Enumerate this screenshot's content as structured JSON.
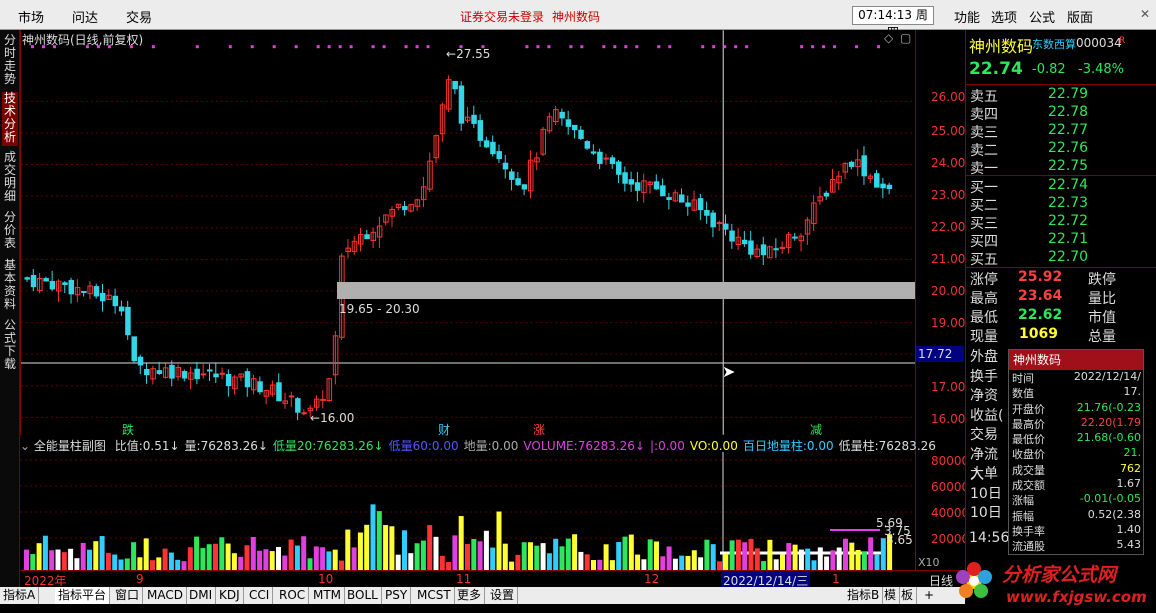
{
  "top": {
    "menu": [
      "市场",
      "问达",
      "交易"
    ],
    "alert": "证券交易未登录",
    "stock_name": "神州数码",
    "time": "07:14:13 周四",
    "right_menu": [
      "功能",
      "选项",
      "公式",
      "版面"
    ]
  },
  "left_tabs": [
    "分时走势",
    "技术分析",
    "成交明细",
    "分价表",
    "基本资料",
    "公式下载"
  ],
  "left_active": 1,
  "chart": {
    "title": "神州数码(日线,前复权)",
    "high_label": "27.55",
    "low_label": "16.00",
    "band_label": "19.65 - 20.30",
    "cursor_value": "17.72",
    "events": [
      "跌",
      "财",
      "涨",
      "减"
    ],
    "y_ticks": [
      "26.00",
      "25.00",
      "24.00",
      "23.00",
      "22.00",
      "21.00",
      "20.00",
      "19.00",
      "18.00",
      "17.00",
      "16.00"
    ]
  },
  "sub": {
    "name": "全能量柱副图",
    "items": [
      {
        "label": "比值:",
        "value": "0.51",
        "arrow": "↓",
        "color": "#dddddd"
      },
      {
        "label": "量:",
        "value": "76283.26",
        "arrow": "↓",
        "color": "#dddddd"
      },
      {
        "label": "低量20:",
        "value": "76283.26",
        "arrow": "↓",
        "color": "#2ee65a"
      },
      {
        "label": "低量60:",
        "value": "0.00",
        "arrow": "",
        "color": "#5555ff"
      },
      {
        "label": "地量:",
        "value": "0.00",
        "arrow": "",
        "color": "#aaaaaa"
      },
      {
        "label": "VOLUME:",
        "value": "76283.26",
        "arrow": "↓",
        "color": "#e040e0"
      },
      {
        "label": "|:",
        "value": "0.00",
        "arrow": "",
        "color": "#e040e0"
      },
      {
        "label": "VO:",
        "value": "0.00",
        "arrow": "",
        "color": "#ffff33"
      },
      {
        "label": "百日地量柱:",
        "value": "0.00",
        "arrow": "",
        "color": "#33ccff"
      },
      {
        "label": "低量柱:",
        "value": "76283.26",
        "arrow": "",
        "color": "#dddddd"
      }
    ],
    "y_ticks": [
      "80000",
      "60000",
      "40000",
      "20000"
    ],
    "labels": {
      "a": "5.69",
      "b": "3.75",
      "c": "3.65",
      "x10": "X10"
    }
  },
  "x_axis": {
    "labels": [
      "2022年",
      "9",
      "10",
      "11",
      "12",
      "1"
    ],
    "cursor_date": "2022/12/14/三",
    "right": "日线"
  },
  "bottom_tabs": [
    "指标A",
    "指标平台",
    "窗口",
    "MACD",
    "DMI",
    "KDJ",
    "CCI",
    "ROC",
    "MTM",
    "BOLL",
    "PSY",
    "MCST",
    "更多",
    "设置"
  ],
  "bottom_active": 1,
  "bottom_right": [
    "指标B",
    "模",
    "板",
    "+"
  ],
  "panel": {
    "name": "神州数码",
    "sub_name": "东数西算",
    "code": "000034",
    "rq": "R",
    "price": "22.74",
    "change": "-0.82",
    "change_pct": "-3.48%",
    "asks": [
      {
        "label": "卖五",
        "price": "22.79"
      },
      {
        "label": "卖四",
        "price": "22.78"
      },
      {
        "label": "卖三",
        "price": "22.77"
      },
      {
        "label": "卖二",
        "price": "22.76"
      },
      {
        "label": "卖一",
        "price": "22.75"
      }
    ],
    "bids": [
      {
        "label": "买一",
        "price": "22.74"
      },
      {
        "label": "买二",
        "price": "22.73"
      },
      {
        "label": "买三",
        "price": "22.72"
      },
      {
        "label": "买四",
        "price": "22.71"
      },
      {
        "label": "买五",
        "price": "22.70"
      }
    ],
    "stats": [
      {
        "label": "涨停",
        "value": "25.92",
        "label2": "跌停",
        "color": "#ff4040"
      },
      {
        "label": "最高",
        "value": "23.64",
        "label2": "量比",
        "color": "#ff4040"
      },
      {
        "label": "最低",
        "value": "22.62",
        "label2": "市值",
        "color": "#2ee65a"
      },
      {
        "label": "现量",
        "value": "1069",
        "label2": "总量",
        "color": "#ffff33"
      }
    ],
    "more_labels": [
      "外盘",
      "换手",
      "净资",
      "收益(",
      "交易",
      "净流入",
      "大单",
      "10日",
      "10日"
    ],
    "time": "14:56"
  },
  "popup": {
    "title": "神州数码",
    "rows": [
      {
        "label": "时间",
        "value": "2022/12/14/",
        "color": "#dddddd"
      },
      {
        "label": "数值",
        "value": "17.",
        "color": "#dddddd"
      },
      {
        "label": "开盘价",
        "value": "21.76(-0.23",
        "color": "#2ee65a"
      },
      {
        "label": "最高价",
        "value": "22.20(1.79",
        "color": "#ff4040"
      },
      {
        "label": "最低价",
        "value": "21.68(-0.60",
        "color": "#2ee65a"
      },
      {
        "label": "收盘价",
        "value": "21.",
        "color": "#2ee65a"
      },
      {
        "label": "成交量",
        "value": "762",
        "color": "#ffff33"
      },
      {
        "label": "成交额",
        "value": "1.67",
        "color": "#dddddd"
      },
      {
        "label": "涨幅",
        "value": "-0.01(-0.05",
        "color": "#2ee65a"
      },
      {
        "label": "振幅",
        "value": "0.52(2.38",
        "color": "#dddddd"
      },
      {
        "label": "换手率",
        "value": "1.40",
        "color": "#dddddd"
      },
      {
        "label": "流通股",
        "value": "5.43",
        "color": "#dddddd"
      }
    ]
  },
  "logo": {
    "text": "分析家公式网",
    "url": "www.fxjgsw.com"
  },
  "colors": {
    "up": "#ff3333",
    "down": "#33d6e6",
    "grid": "#800000",
    "cursor": "#dddddd"
  }
}
